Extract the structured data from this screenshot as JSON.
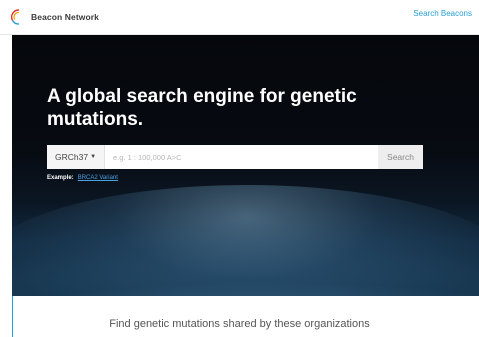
{
  "header": {
    "logo_text": "Beacon Network",
    "nav_link": "Search Beacons"
  },
  "hero": {
    "title": "A global search engine for genetic mutations.",
    "assembly": {
      "selected": "GRCh37"
    },
    "search": {
      "placeholder": "e.g. 1 : 100,000 A>C",
      "button_label": "Search"
    },
    "example": {
      "label": "Example:",
      "link": "BRCA2 Variant"
    }
  },
  "main": {
    "tagline": "Find genetic mutations shared by these organizations"
  },
  "colors": {
    "accent": "#2a9fd6",
    "hero_dark": "#05070b",
    "button_bg": "#eeeeee"
  },
  "icons": [
    "beacon-logo-icon",
    "caret-down-icon"
  ]
}
